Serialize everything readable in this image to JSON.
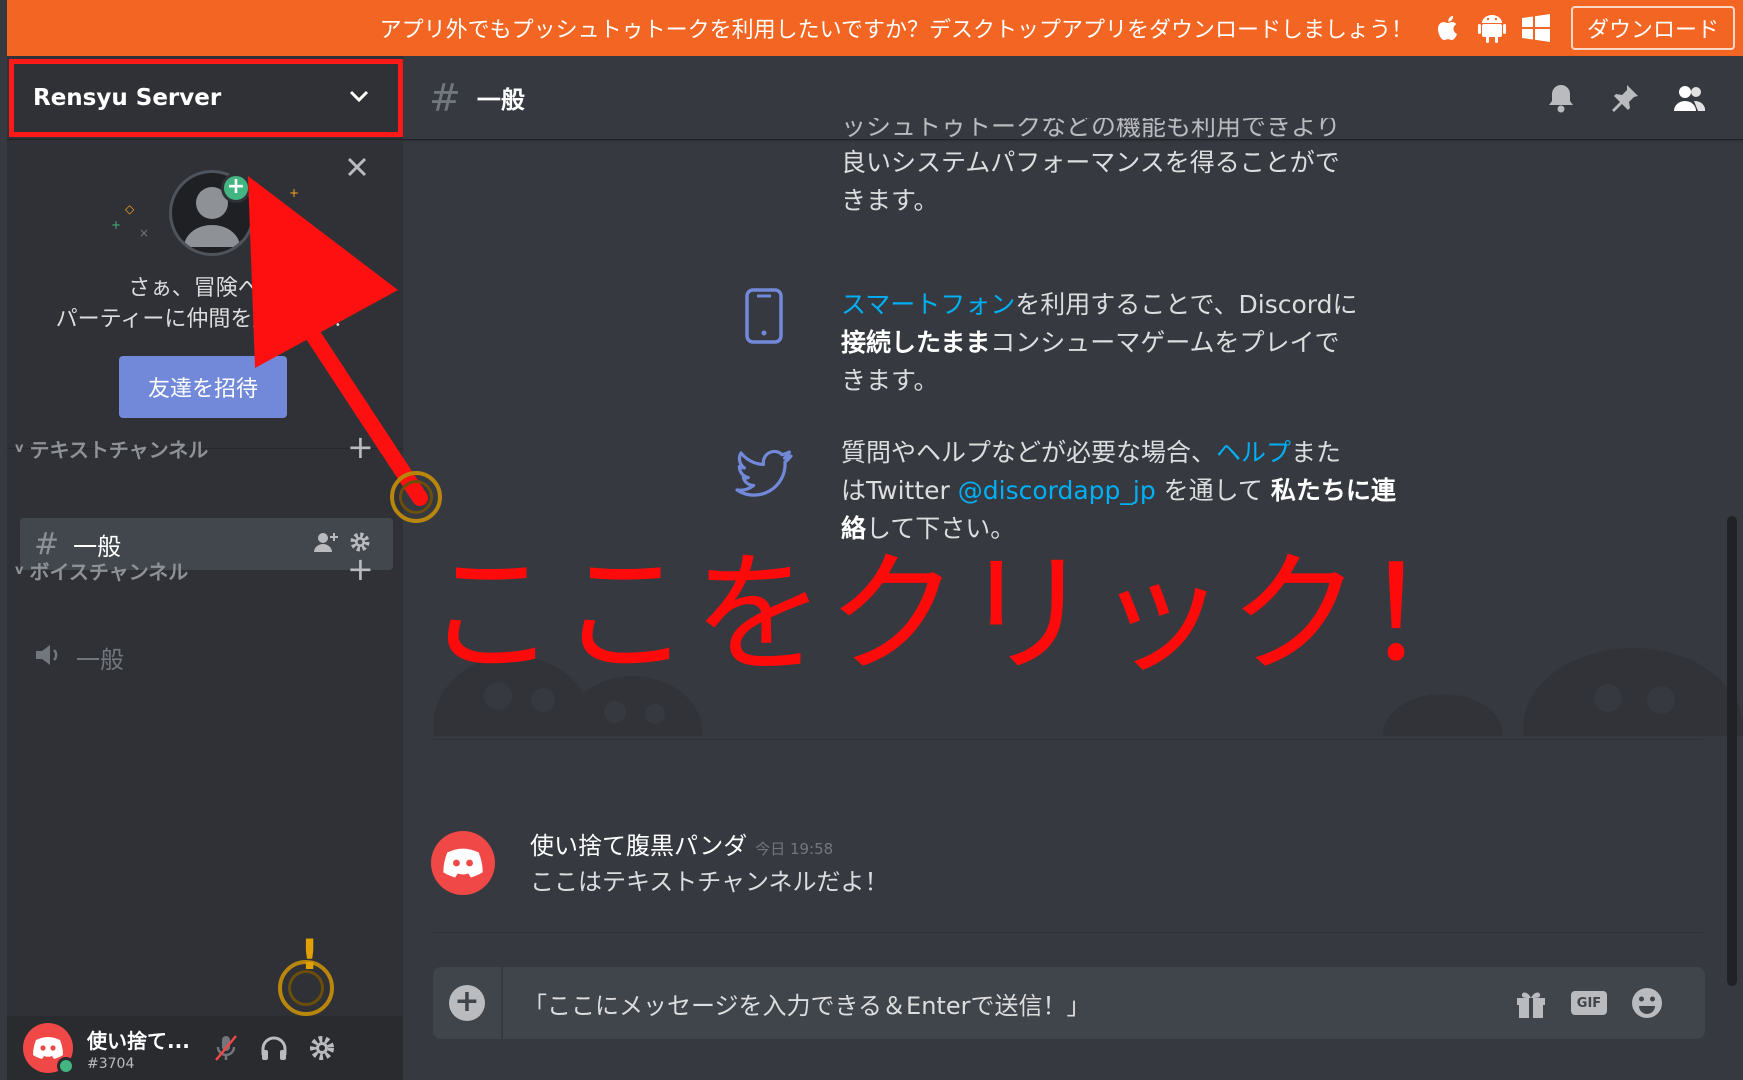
{
  "banner": {
    "text": "アプリ外でもプッシュトゥトークを利用したいですか？デスクトップアプリをダウンロードしましょう！",
    "download_label": "ダウンロード"
  },
  "sidebar": {
    "server_name": "Rensyu Server",
    "invite": {
      "line1": "さぁ、冒険へ出",
      "line2": "パーティーに仲間を加",
      "line2_tail": "！",
      "button_label": "友達を招待"
    },
    "categories": [
      {
        "label": "テキストチャンネル"
      },
      {
        "label": "ボイスチャンネル"
      }
    ],
    "text_channel": {
      "hash": "#",
      "name": "一般"
    },
    "voice_channel": {
      "name": "一般"
    },
    "user": {
      "name": "使い捨て...",
      "tag": "#3704"
    }
  },
  "main": {
    "channel_hash": "#",
    "channel_title": "一般",
    "features": {
      "f1_top": "ッシュトゥトークなどの機能も利用できより",
      "f1_line2": "良いシステムパフォーマンスを得ることがで",
      "f1_line3": "きます。",
      "f2_link": "スマートフォン",
      "f2_a": "を利用することで、Discordに",
      "f2_bold": "接続したまま",
      "f2_b": "コンシューマゲームをプレイで",
      "f2_c": "きます。",
      "f3_a": "質問やヘルプなどが必要な場合、",
      "f3_link1": "ヘルプ",
      "f3_b": "また",
      "f3_c": "はTwitter ",
      "f3_link2": "@discordapp_jp",
      "f3_d": " を通して ",
      "f3_bold1": "私たちに連",
      "f3_bold2": "絡",
      "f3_e": "して下さい。"
    },
    "message": {
      "author": "使い捨て腹黒パンダ",
      "timestamp": "今日 19:58",
      "text": "ここはテキストチャンネルだよ！"
    },
    "composer": {
      "value": "「ここにメッセージを入力できる＆Enterで送信！」",
      "gif_label": "GIF"
    }
  },
  "annotation": {
    "text": "ここをクリック！",
    "excl": "!"
  },
  "colors": {
    "banner": "#f26522",
    "accent": "#7289da",
    "annotation": "#ff0a0a",
    "link": "#00b0f4",
    "online": "#43b581"
  }
}
